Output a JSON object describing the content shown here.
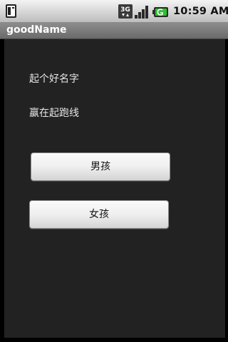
{
  "status_bar": {
    "network": "3G",
    "time": "10:59 AM"
  },
  "title_bar": {
    "title": "goodName"
  },
  "main": {
    "line1": "起个好名字",
    "line2": "赢在起跑线",
    "boy_button_label": "男孩",
    "girl_button_label": "女孩"
  }
}
